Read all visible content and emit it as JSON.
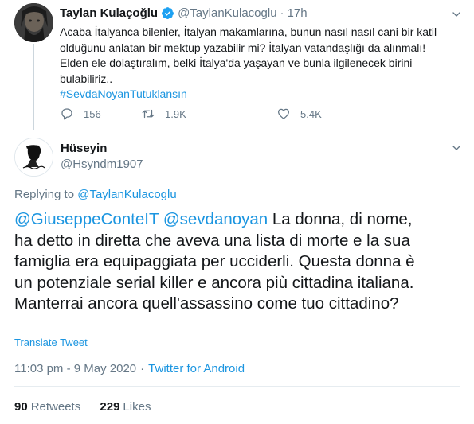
{
  "parent_tweet": {
    "author_name": "Taylan Kulaçoğlu",
    "author_handle": "@TaylanKulacoglu",
    "separator": "·",
    "time": "17h",
    "text_lines": [
      "Acaba İtalyanca bilenler, İtalyan makamlarına, bunun nasıl nasıl cani bir katil",
      "olduğunu anlatan bir mektup yazabilir mi? İtalyan vatandaşlığı da alınmalı!",
      "Elden ele dolaştıralım, belki İtalya'da yaşayan ve bunla ilgilenecek birini",
      "bulabiliriz.."
    ],
    "hashtag": "#SevdaNoyanTutuklansın",
    "reply_count": "156",
    "retweet_count": "1.9K",
    "like_count": "5.4K"
  },
  "main_tweet": {
    "author_name": "Hüseyin",
    "author_handle": "@Hsyndm1907",
    "replying_prefix": "Replying to ",
    "replying_to": "@TaylanKulacoglu",
    "mention_1": "@GiuseppeConteIT",
    "mention_2": "@sevdanoyan",
    "text_line_1_rest": " La donna, di nome,",
    "text_lines": [
      "ha detto in diretta che aveva una lista di morte e la sua",
      "famiglia era equipaggiata per ucciderli. Questa donna è",
      "un potenziale serial killer e ancora più cittadina italiana.",
      "Manterrai ancora quell'assassino come tuo cittadino?"
    ],
    "translate_label": "Translate Tweet",
    "time": "11:03 pm - 9 May 2020",
    "meta_separator": "·",
    "client": "Twitter for Android",
    "retweets_count": "90",
    "retweets_label": "Retweets",
    "likes_count": "229",
    "likes_label": "Likes"
  },
  "colors": {
    "link": "#1b95e0",
    "secondary_text": "#657786",
    "primary_text": "#14171a",
    "verified": "#1da1f2"
  }
}
